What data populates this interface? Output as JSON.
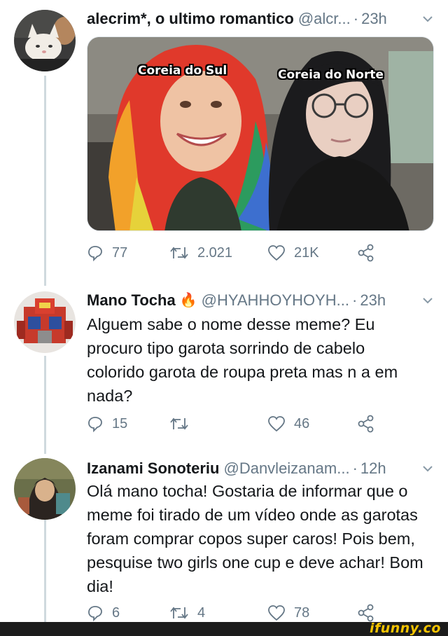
{
  "tweets": [
    {
      "name": "alecrim*, o ultimo romantico",
      "handle": "@alcr...",
      "time": "23h",
      "media": {
        "caption_left": "Coreia do Sul",
        "caption_right": "Coreia do Norte"
      },
      "actions": {
        "replies": "77",
        "retweets": "2.021",
        "likes": "21K"
      }
    },
    {
      "name": "Mano Tocha",
      "emoji": "🔥",
      "handle": "@HYAHHOYHOYH...",
      "time": "23h",
      "text": "Alguem sabe o nome desse meme? Eu procuro tipo garota sorrindo de cabelo colorido garota de roupa preta mas n a em nada?",
      "actions": {
        "replies": "15",
        "retweets": "",
        "likes": "46"
      }
    },
    {
      "name": "Izanami Sonoteriu",
      "handle": "@Danvleizanam...",
      "time": "12h",
      "text": "Olá mano tocha! Gostaria de informar que o meme foi tirado de um vídeo onde as garotas foram comprar copos super caros! Pois bem, pesquise two girls one cup e deve achar! Bom dia!",
      "actions": {
        "replies": "6",
        "retweets": "4",
        "likes": "78"
      }
    }
  ],
  "icons": [
    "reply-icon",
    "retweet-icon",
    "like-icon",
    "share-icon",
    "chevron-down-icon"
  ],
  "colors": {
    "text": "#14171a",
    "muted": "#657786",
    "thread_line": "#cfd9de",
    "footer": "#1c1c1c",
    "brand": "#f5c400"
  },
  "footer": {
    "brand": "ifunny.co"
  }
}
